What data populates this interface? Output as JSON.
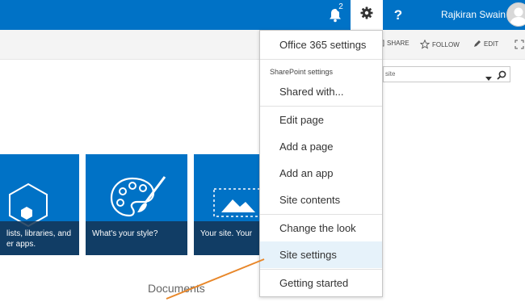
{
  "suite_bar": {
    "notification_count": "2",
    "help_label": "?",
    "user_name": "Rajkiran Swain",
    "accent_color": "#0072c6"
  },
  "page_actions": {
    "share": "SHARE",
    "follow": "FOLLOW",
    "edit": "EDIT"
  },
  "search": {
    "text": "site"
  },
  "tiles": [
    {
      "caption_line1": "lists, libraries, and",
      "caption_line2": "er apps.",
      "icon": "hexagon-icon"
    },
    {
      "caption_line1": "What's your style?",
      "icon": "palette-icon"
    },
    {
      "caption_line1": "Your site. Your",
      "icon": "picture-icon"
    }
  ],
  "documents_heading": "Documents",
  "settings_menu": {
    "office365": "Office 365 settings",
    "section_label": "SharePoint settings",
    "shared_with": "Shared with...",
    "edit_page": "Edit page",
    "add_page": "Add a page",
    "add_app": "Add an app",
    "site_contents": "Site contents",
    "change_look": "Change the look",
    "site_settings": "Site settings",
    "getting_started": "Getting started"
  },
  "annotation_color": "#e8872a"
}
